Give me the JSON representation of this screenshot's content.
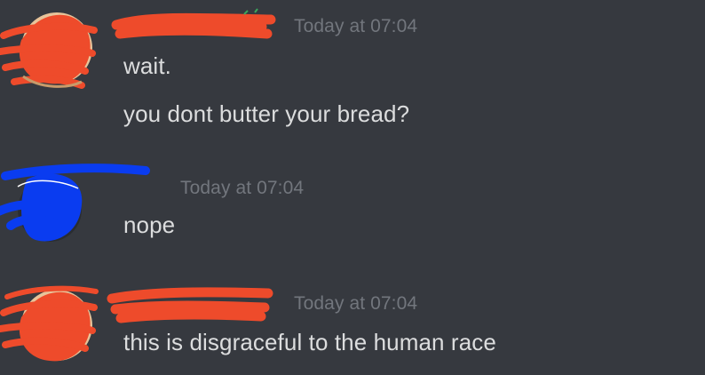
{
  "channel": {
    "messages": [
      {
        "author_redacted": true,
        "redaction_color": "#ee4b2b",
        "timestamp": "Today at 07:04",
        "lines": [
          "wait.",
          "you dont butter your bread?"
        ]
      },
      {
        "author_redacted": true,
        "redaction_color": "#0a3cf0",
        "timestamp": "Today at 07:04",
        "lines": [
          "nope"
        ]
      },
      {
        "author_redacted": true,
        "redaction_color": "#ee4b2b",
        "timestamp": "Today at 07:04",
        "lines": [
          "this is disgraceful to the human race"
        ]
      }
    ]
  },
  "colors": {
    "background": "#36393f",
    "message_text": "#dcddde",
    "timestamp_text": "#72767d",
    "red_scribble": "#ee4b2b",
    "blue_scribble": "#0a3cf0",
    "avatar_base": "#e9c9a0"
  }
}
